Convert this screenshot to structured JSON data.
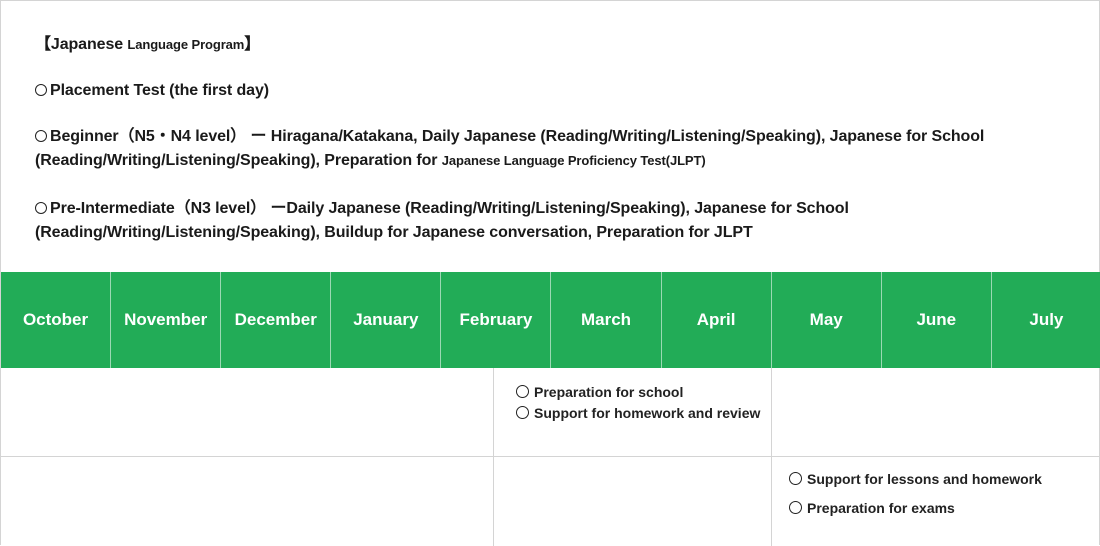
{
  "intro": {
    "heading_open": "【Japanese ",
    "heading_small": "Language Program",
    "heading_close": "】",
    "placement": "Placement Test (the first day)",
    "beginner_line1": "Beginner（N5・N4 level） ー Hiragana/Katakana, Daily Japanese (Reading/Writing/Listening/Speaking), Japanese for School",
    "beginner_line2": "(Reading/Writing/Listening/Speaking), Preparation for ",
    "beginner_line2_small": "Japanese Language Proficiency Test(JLPT)",
    "preint_line1": "Pre-Intermediate（N3 level） ーDaily Japanese (Reading/Writing/Listening/Speaking), Japanese for School",
    "preint_line2": "(Reading/Writing/Listening/Speaking), Buildup for Japanese conversation,  Preparation for JLPT"
  },
  "months": [
    "October",
    "November",
    "December",
    "January",
    "February",
    "March",
    "April",
    "May",
    "June",
    "July"
  ],
  "schedule": {
    "row1": {
      "items": [
        "Preparation for school",
        "Support for homework and review"
      ]
    },
    "row2": {
      "items": [
        "Support for lessons and homework",
        "Preparation for exams"
      ]
    }
  },
  "colors": {
    "accent": "#22ac57",
    "grid": "#d4d4d4"
  }
}
